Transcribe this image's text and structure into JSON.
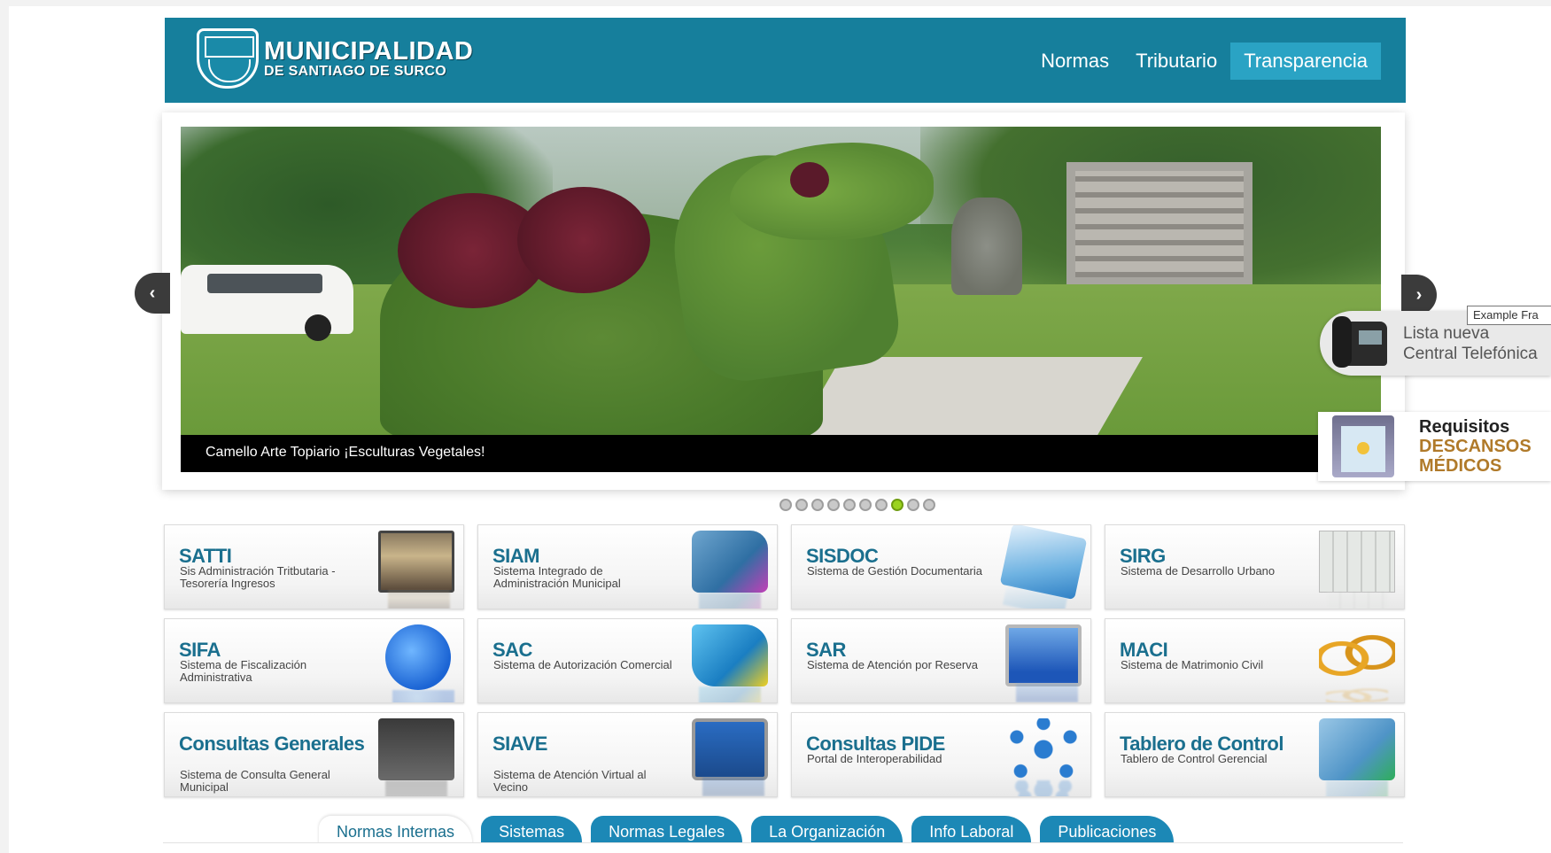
{
  "header": {
    "logo_line1": "MUNICIPALIDAD",
    "logo_line2": "DE SANTIAGO DE SURCO",
    "nav": [
      {
        "label": "Normas",
        "active": false
      },
      {
        "label": "Tributario",
        "active": false
      },
      {
        "label": "Transparencia",
        "active": true
      }
    ]
  },
  "slider": {
    "caption": "Camello Arte Topiario ¡Esculturas Vegetales!",
    "prev_label": "‹",
    "next_label": "›",
    "dot_count": 10,
    "active_dot": 8
  },
  "phone_widget": {
    "badge": "Example Fra",
    "line1": "Lista nueva",
    "line2": "Central Telefónica"
  },
  "req_widget": {
    "line1": "Requisitos",
    "line2": "DESCANSOS",
    "line3": "MÉDICOS"
  },
  "tiles": [
    {
      "title": "SATTI",
      "desc": "Sis Administración Tritbutaria - Tesorería Ingresos",
      "icon": "monitor-icon"
    },
    {
      "title": "SIAM",
      "desc": "Sistema Integrado de Administración Municipal",
      "icon": "folder-cubes-icon"
    },
    {
      "title": "SISDOC",
      "desc": "Sistema de Gestión Documentaria",
      "icon": "documents-pen-icon"
    },
    {
      "title": "SIRG",
      "desc": "Sistema de Desarrollo Urbano",
      "icon": "map-icon"
    },
    {
      "title": "SIFA",
      "desc": "Sistema de Fiscalización Administrativa",
      "icon": "magnifier-icon"
    },
    {
      "title": "SAC",
      "desc": "Sistema de Autorización Comercial",
      "icon": "folder-color-icon"
    },
    {
      "title": "SAR",
      "desc": "Sistema de Atención por Reserva",
      "icon": "computer-icon"
    },
    {
      "title": "MACI",
      "desc": "Sistema de Matrimonio Civil",
      "icon": "rings-icon"
    },
    {
      "title": "Consultas Generales",
      "desc": "Sistema de Consulta General Municipal",
      "icon": "monitor-users-icon"
    },
    {
      "title": "SIAVE",
      "desc": "Sistema de Atención Virtual al Vecino",
      "icon": "screens-icon"
    },
    {
      "title": "Consultas PIDE",
      "desc": "Portal de Interoperabilidad",
      "icon": "network-icon"
    },
    {
      "title": "Tablero de Control",
      "desc": "Tablero de Control Gerencial",
      "icon": "folder-chart-icon"
    }
  ],
  "tabs": [
    {
      "label": "Normas Internas",
      "active": true
    },
    {
      "label": "Sistemas",
      "active": false
    },
    {
      "label": "Normas Legales",
      "active": false
    },
    {
      "label": "La Organización",
      "active": false
    },
    {
      "label": "Info Laboral",
      "active": false
    },
    {
      "label": "Publicaciones",
      "active": false
    }
  ]
}
